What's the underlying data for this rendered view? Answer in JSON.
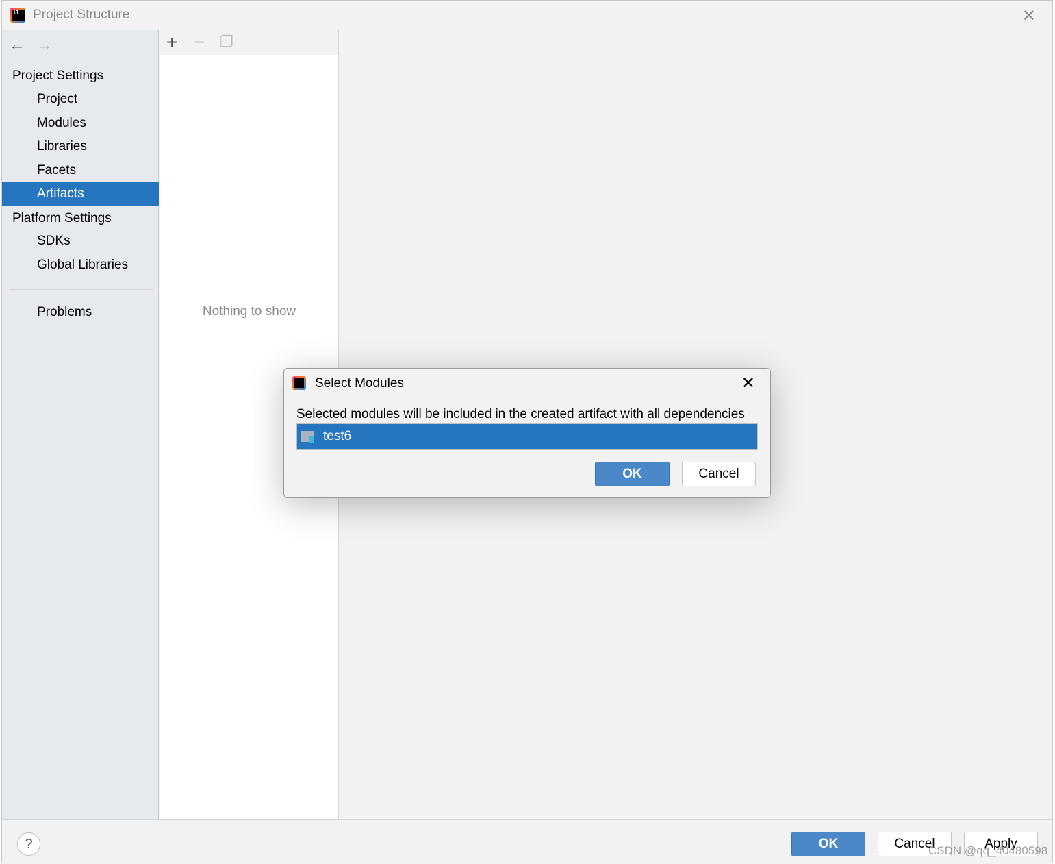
{
  "window": {
    "title": "Project Structure",
    "close_icon": "close-icon"
  },
  "sidebar": {
    "project_settings": "Project Settings",
    "project_items": [
      {
        "label": "Project"
      },
      {
        "label": "Modules"
      },
      {
        "label": "Libraries"
      },
      {
        "label": "Facets"
      },
      {
        "label": "Artifacts",
        "selected": true
      }
    ],
    "platform_settings": "Platform Settings",
    "platform_items": [
      {
        "label": "SDKs"
      },
      {
        "label": "Global Libraries"
      }
    ],
    "problems": "Problems"
  },
  "middle": {
    "empty_text": "Nothing to show"
  },
  "dialog": {
    "title": "Select Modules",
    "message": "Selected modules will be included in the created artifact with all dependencies",
    "modules": [
      {
        "name": "test6",
        "selected": true
      }
    ],
    "ok": "OK",
    "cancel": "Cancel"
  },
  "footer": {
    "help": "?",
    "ok": "OK",
    "cancel": "Cancel",
    "apply": "Apply"
  },
  "watermark": "CSDN @qq_40480598",
  "colors": {
    "accent": "#2675bf",
    "primary_button": "#4a88c7"
  }
}
